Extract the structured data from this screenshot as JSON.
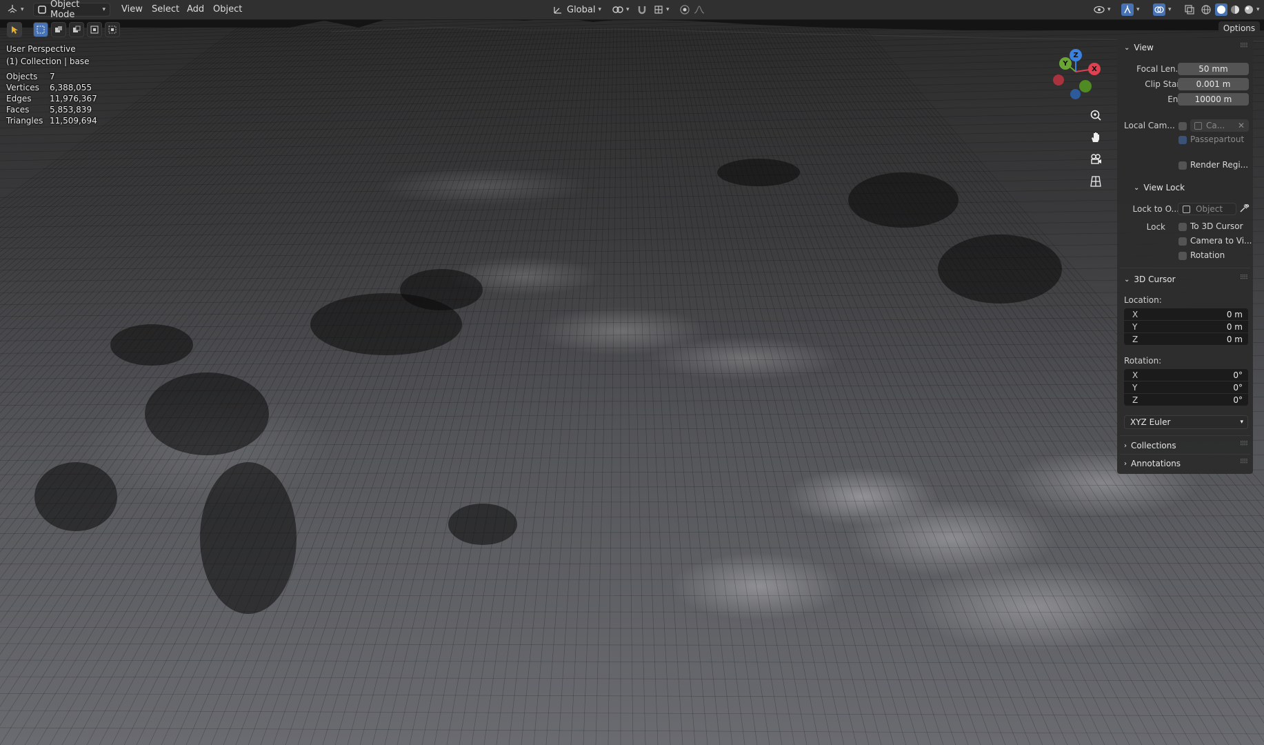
{
  "header": {
    "editor_type_icon": "3d-viewport-icon",
    "mode": "Object Mode",
    "menus": [
      "View",
      "Select",
      "Add",
      "Object"
    ],
    "transform_orientation": "Global"
  },
  "overlay": {
    "view_name": "User Perspective",
    "collection": "(1) Collection | base",
    "stats": [
      {
        "label": "Objects",
        "value": "7"
      },
      {
        "label": "Vertices",
        "value": "6,388,055"
      },
      {
        "label": "Edges",
        "value": "11,976,367"
      },
      {
        "label": "Faces",
        "value": "5,853,839"
      },
      {
        "label": "Triangles",
        "value": "11,509,694"
      }
    ]
  },
  "gizmo": {
    "x": "X",
    "y": "Y",
    "z": "Z"
  },
  "options_label": "Options",
  "sidebar": {
    "view": {
      "title": "View",
      "focal_label": "Focal Len...",
      "focal_value": "50 mm",
      "clip_start_label": "Clip Start",
      "clip_start_value": "0.001 m",
      "end_label": "End",
      "end_value": "10000 m",
      "local_cam_label": "Local Cam...",
      "local_cam_value": "Ca...",
      "passepartout_label": "Passepartout",
      "render_region_label": "Render Regi..."
    },
    "view_lock": {
      "title": "View Lock",
      "lock_to_label": "Lock to O...",
      "lock_to_placeholder": "Object",
      "lock_label": "Lock",
      "to_cursor_label": "To 3D Cursor",
      "camera_to_view_label": "Camera to Vi...",
      "rotation_label": "Rotation"
    },
    "cursor": {
      "title": "3D Cursor",
      "location_label": "Location:",
      "location": [
        {
          "axis": "X",
          "value": "0 m"
        },
        {
          "axis": "Y",
          "value": "0 m"
        },
        {
          "axis": "Z",
          "value": "0 m"
        }
      ],
      "rotation_label": "Rotation:",
      "rotation": [
        {
          "axis": "X",
          "value": "0°"
        },
        {
          "axis": "Y",
          "value": "0°"
        },
        {
          "axis": "Z",
          "value": "0°"
        }
      ],
      "rotation_mode": "XYZ Euler"
    },
    "collections_title": "Collections",
    "annotations_title": "Annotations"
  },
  "colors": {
    "accent": "#4772b3",
    "gizmo_x": "#e0404f",
    "gizmo_y": "#6aa633",
    "gizmo_z": "#3b82e0"
  }
}
